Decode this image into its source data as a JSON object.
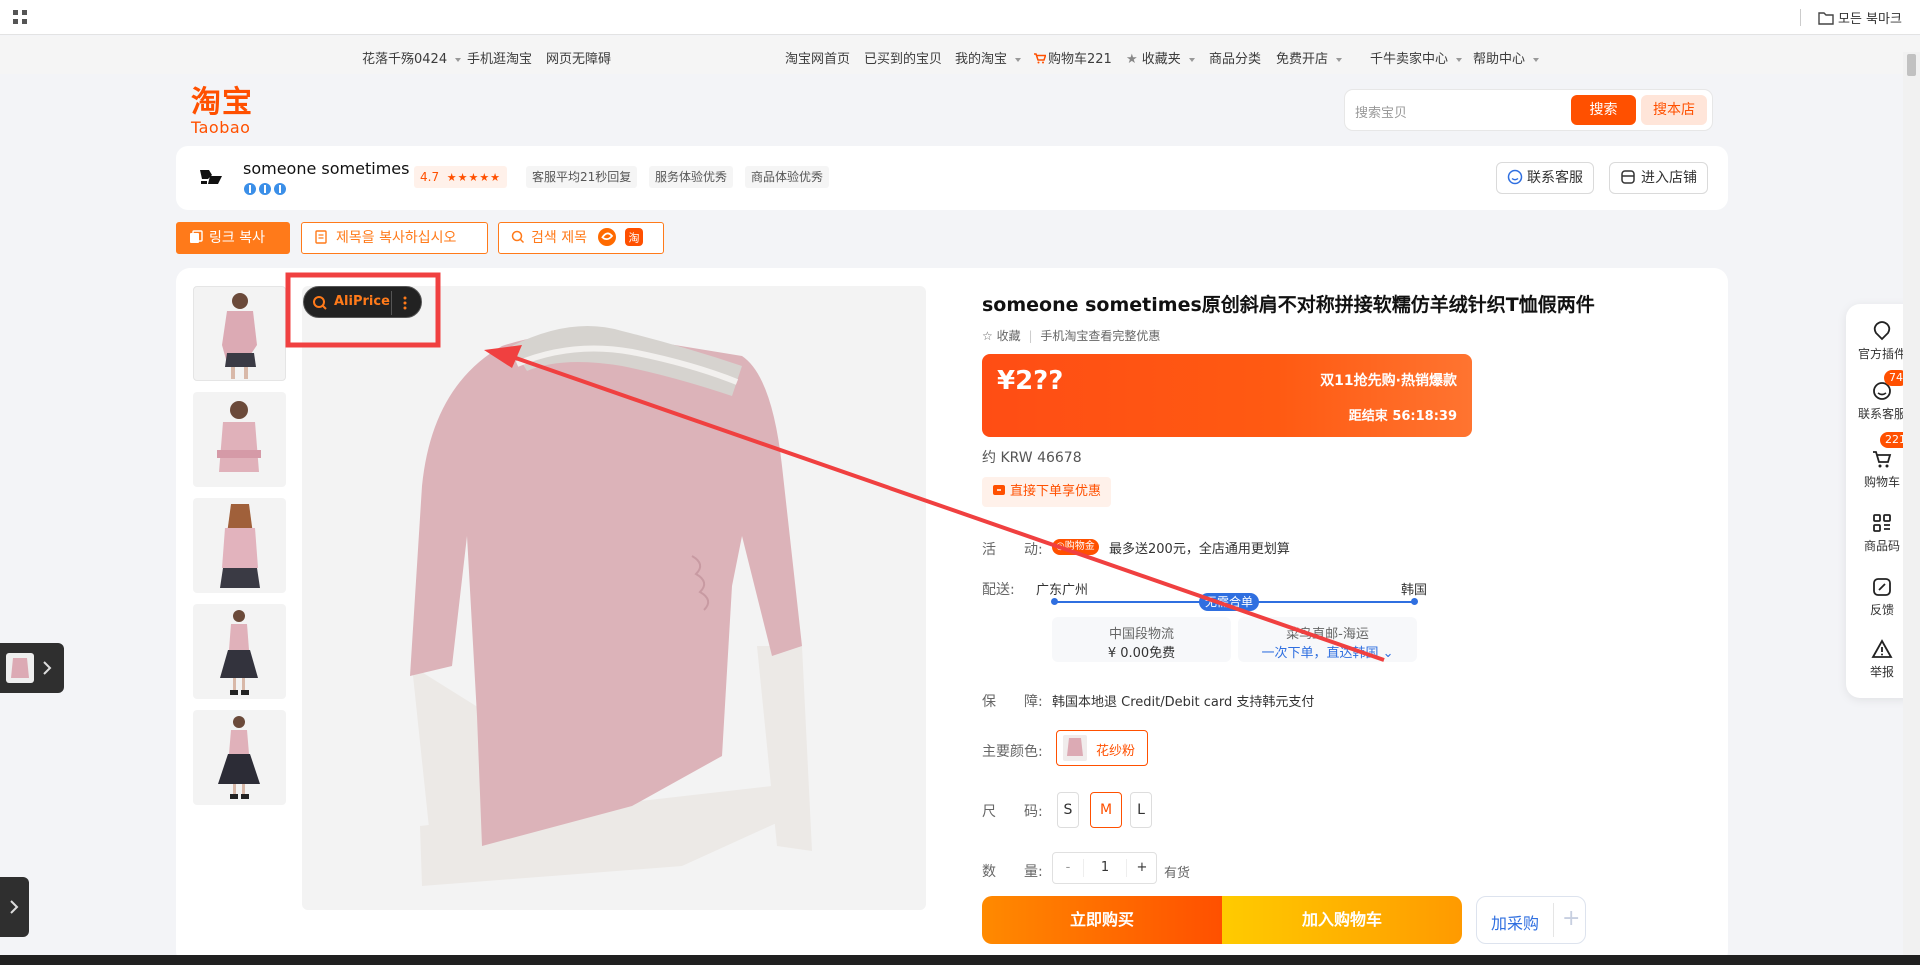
{
  "bookmarks_bar": {
    "apps_icon": "grid-icon",
    "all_bookmarks": "모든 북마크"
  },
  "site_nav": {
    "left": [
      "花落千殇0424",
      "手机逛淘宝",
      "网页无障碍"
    ],
    "right": [
      "淘宝网首页",
      "已买到的宝贝",
      "我的淘宝",
      "购物车221",
      "收藏夹",
      "商品分类",
      "免费开店",
      "千牛卖家中心",
      "帮助中心"
    ]
  },
  "logo": {
    "cn": "淘宝",
    "en": "Taobao"
  },
  "search": {
    "placeholder": "搜索宝贝",
    "search_btn": "搜索",
    "shop_btn": "搜本店"
  },
  "shop": {
    "name": "someone sometimes",
    "rating": "4.7",
    "stars": "★★★★★",
    "tags": [
      "客服平均21秒回复",
      "服务体验优秀",
      "商品体验优秀"
    ],
    "contact_btn": "联系客服",
    "enter_btn": "进入店铺"
  },
  "extension_bar": {
    "copy_link": "링크 복사",
    "copy_title": "제목을 복사하십시오",
    "search_title": "검색 제목"
  },
  "aliprice": {
    "label": "AliPrice"
  },
  "product": {
    "title": "someone sometimes原创斜肩不对称拼接软糯仿羊绒针织T恤假两件",
    "fav": "收藏",
    "mobile_note": "手机淘宝查看完整优惠",
    "price": "¥2??",
    "promo_title": "双11抢先购·热销爆款",
    "countdown": "距结束 56:18:39",
    "krw": "约 KRW 46678",
    "direct_discount": "直接下单享优惠",
    "activity_label": "活　　动:",
    "activity_badge": "购物金",
    "activity_text": "最多送200元，全店通用更划算",
    "delivery_label": "配送:",
    "delivery_from": "广东广州",
    "delivery_to": "韩国",
    "delivery_badge": "无需合单",
    "logistics_cn_title": "中国段物流",
    "logistics_cn_price": "¥ 0.00免费",
    "logistics_intl_title": "菜鸟直邮-海运",
    "logistics_intl_note": "一次下单，直达韩国",
    "guarantee_label": "保　　障:",
    "guarantee_text": "韩国本地退 Credit/Debit card 支持韩元支付",
    "color_label": "主要颜色:",
    "color_value": "花纱粉",
    "size_label": "尺　　码:",
    "sizes": [
      "S",
      "M",
      "L"
    ],
    "selected_size": "M",
    "qty_label": "数　　量:",
    "qty_value": "1",
    "minus": "-",
    "plus": "+",
    "stock": "有货",
    "buy_now": "立即购买",
    "add_cart": "加入购物车",
    "add_purchase": "加采购",
    "add_purchase_plus": "+"
  },
  "side_panel": {
    "items": [
      {
        "label": "官方插件",
        "icon": "plugin-icon"
      },
      {
        "label": "联系客服",
        "icon": "service-icon",
        "badge": "74"
      },
      {
        "label": "购物车",
        "icon": "cart-icon",
        "badge": "221"
      },
      {
        "label": "商品码",
        "icon": "qrcode-icon"
      },
      {
        "label": "反馈",
        "icon": "feedback-icon"
      },
      {
        "label": "举报",
        "icon": "report-icon"
      }
    ]
  },
  "colors": {
    "accent": "#ff5000",
    "annotation": "#f04040",
    "buy_now": "#ff5000",
    "add_cart": "#ffc400",
    "link_blue": "#2f6fe0"
  }
}
